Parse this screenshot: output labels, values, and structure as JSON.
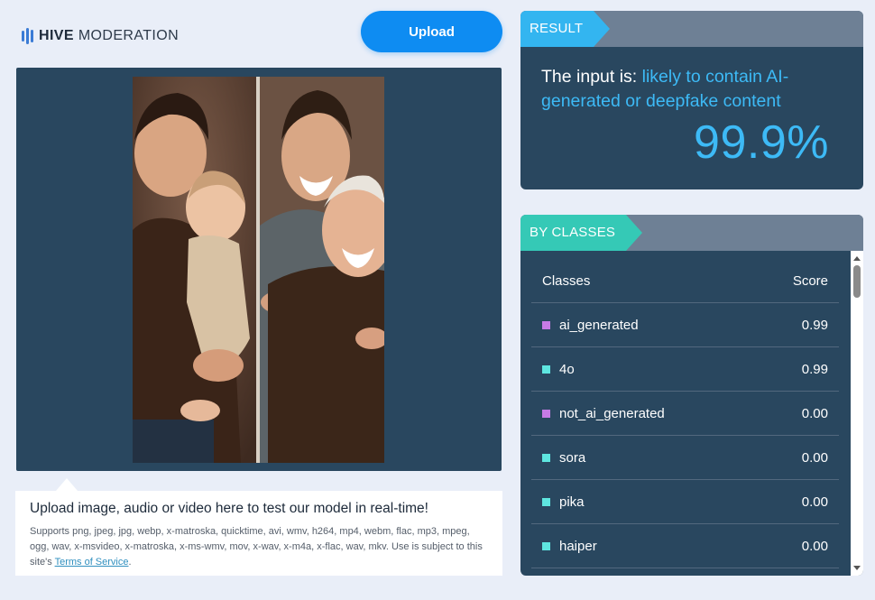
{
  "header": {
    "brand_bold": "HIVE",
    "brand_light": "MODERATION",
    "upload_label": "Upload"
  },
  "media": {
    "info_title": "Upload image, audio or video here to test our model in real-time!",
    "info_text": "Supports png, jpeg, jpg, webp, x-matroska, quicktime, avi, wmv, h264, mp4, webm, flac, mp3, mpeg, ogg, wav, x-msvideo, x-matroska, x-ms-wmv, mov, x-wav, x-m4a, x-flac, wav, mkv. Use is subject to this site's ",
    "terms_link": "Terms of Service",
    "info_text_end": "."
  },
  "result": {
    "tag": "RESULT",
    "prefix": "The input is: ",
    "verdict": "likely to contain AI-generated or deepfake content",
    "score": "99.9%"
  },
  "classes": {
    "tag": "BY CLASSES",
    "col_classes": "Classes",
    "col_score": "Score",
    "rows": [
      {
        "name": "ai_generated",
        "score": "0.99",
        "color": "#c77be6"
      },
      {
        "name": "4o",
        "score": "0.99",
        "color": "#5ee6e0"
      },
      {
        "name": "not_ai_generated",
        "score": "0.00",
        "color": "#c77be6"
      },
      {
        "name": "sora",
        "score": "0.00",
        "color": "#5ee6e0"
      },
      {
        "name": "pika",
        "score": "0.00",
        "color": "#5ee6e0"
      },
      {
        "name": "haiper",
        "score": "0.00",
        "color": "#5ee6e0"
      }
    ]
  },
  "colors": {
    "accent_blue": "#33b5f0",
    "accent_teal": "#35c9b6",
    "panel_bg": "#29475f",
    "upload_btn": "#0e8cf2"
  }
}
